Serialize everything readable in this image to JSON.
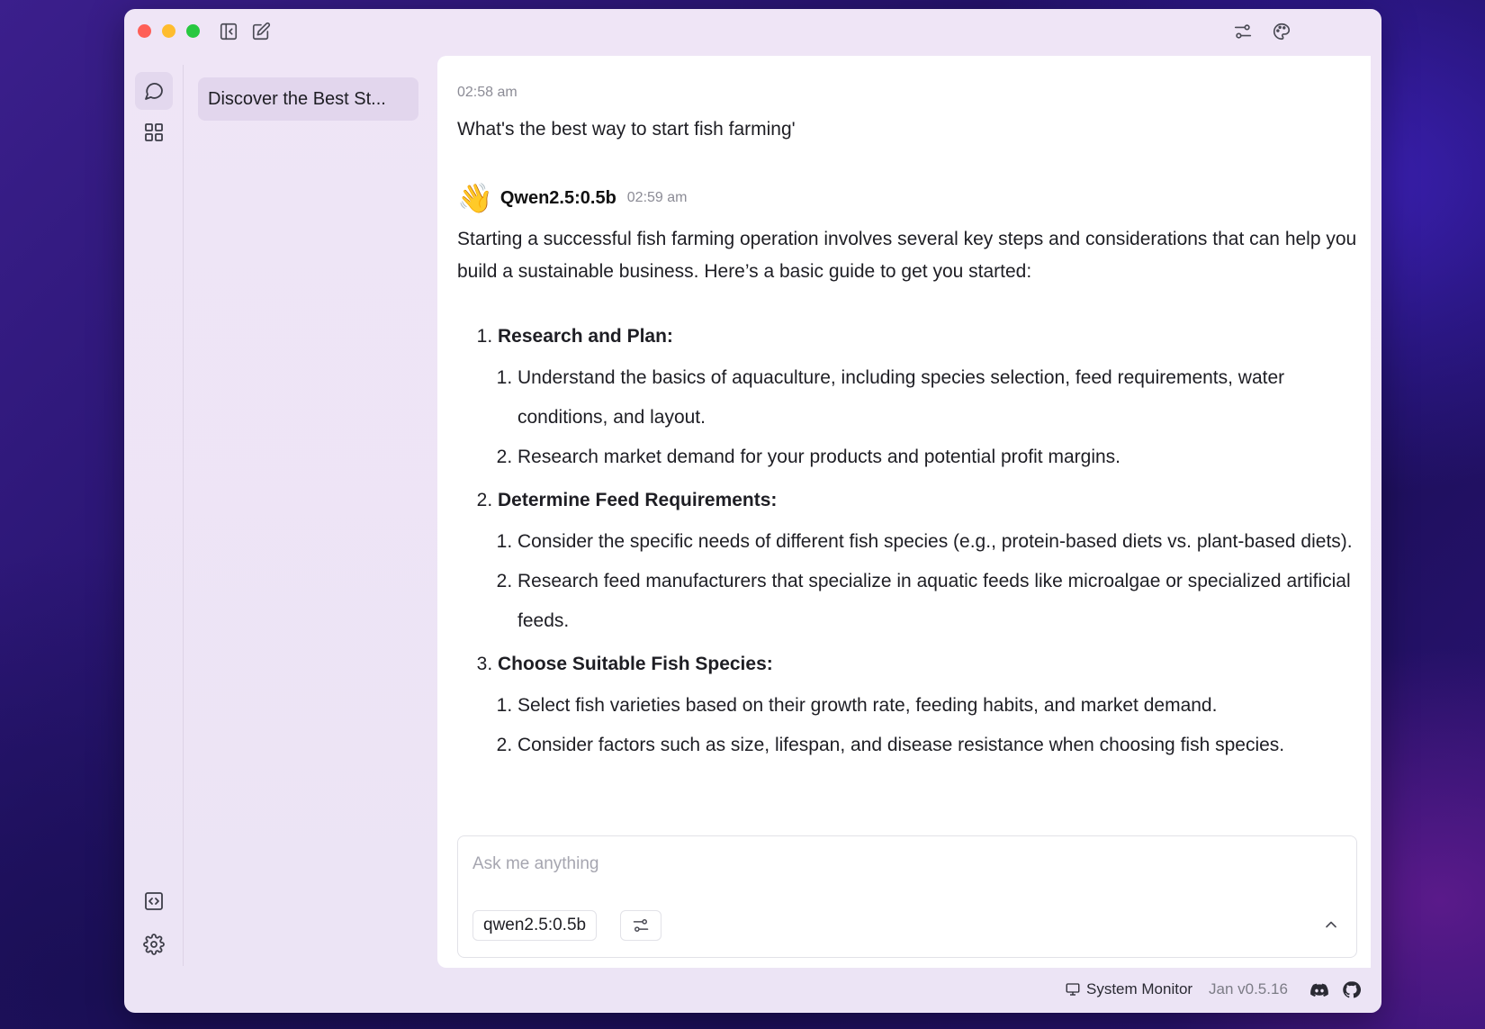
{
  "thread_list": {
    "items": [
      {
        "title": "Discover the Best St..."
      }
    ]
  },
  "chat": {
    "user_message": {
      "time": "02:58 am",
      "text": "What's the best way to start fish farming'"
    },
    "assistant": {
      "emoji": "👋",
      "name": "Qwen2.5:0.5b",
      "time": "02:59 am",
      "intro": "Starting a successful fish farming operation involves several key steps and considerations that can help you build a sustainable business. Here’s a basic guide to get you started:",
      "steps": [
        {
          "title": "Research and Plan:",
          "items": [
            "Understand the basics of aquaculture, including species selection, feed requirements, water conditions, and layout.",
            "Research market demand for your products and potential profit margins."
          ]
        },
        {
          "title": "Determine Feed Requirements:",
          "items": [
            "Consider the specific needs of different fish species (e.g., protein-based diets vs. plant-based diets).",
            "Research feed manufacturers that specialize in aquatic feeds like microalgae or specialized artificial feeds."
          ]
        },
        {
          "title": "Choose Suitable Fish Species:",
          "items": [
            "Select fish varieties based on their growth rate, feeding habits, and market demand.",
            "Consider factors such as size, lifespan, and disease resistance when choosing fish species."
          ]
        }
      ]
    }
  },
  "composer": {
    "placeholder": "Ask me anything",
    "model": "qwen2.5:0.5b"
  },
  "statusbar": {
    "system_monitor": "System Monitor",
    "version": "Jan v0.5.16"
  },
  "icons": {
    "chat": "chat-bubble-icon",
    "hub": "grid-icon",
    "api": "code-square-icon",
    "settings": "gear-icon",
    "sidebar_toggle": "sidebar-left-icon",
    "new_chat": "edit-icon",
    "sliders": "sliders-icon",
    "theme": "palette-icon",
    "discord": "discord-icon",
    "github": "github-icon"
  },
  "colors": {
    "window_bg": "#efe5f6",
    "active_bg": "#e2d6ed",
    "text": "#1e1e24",
    "muted": "#8c8c96"
  }
}
